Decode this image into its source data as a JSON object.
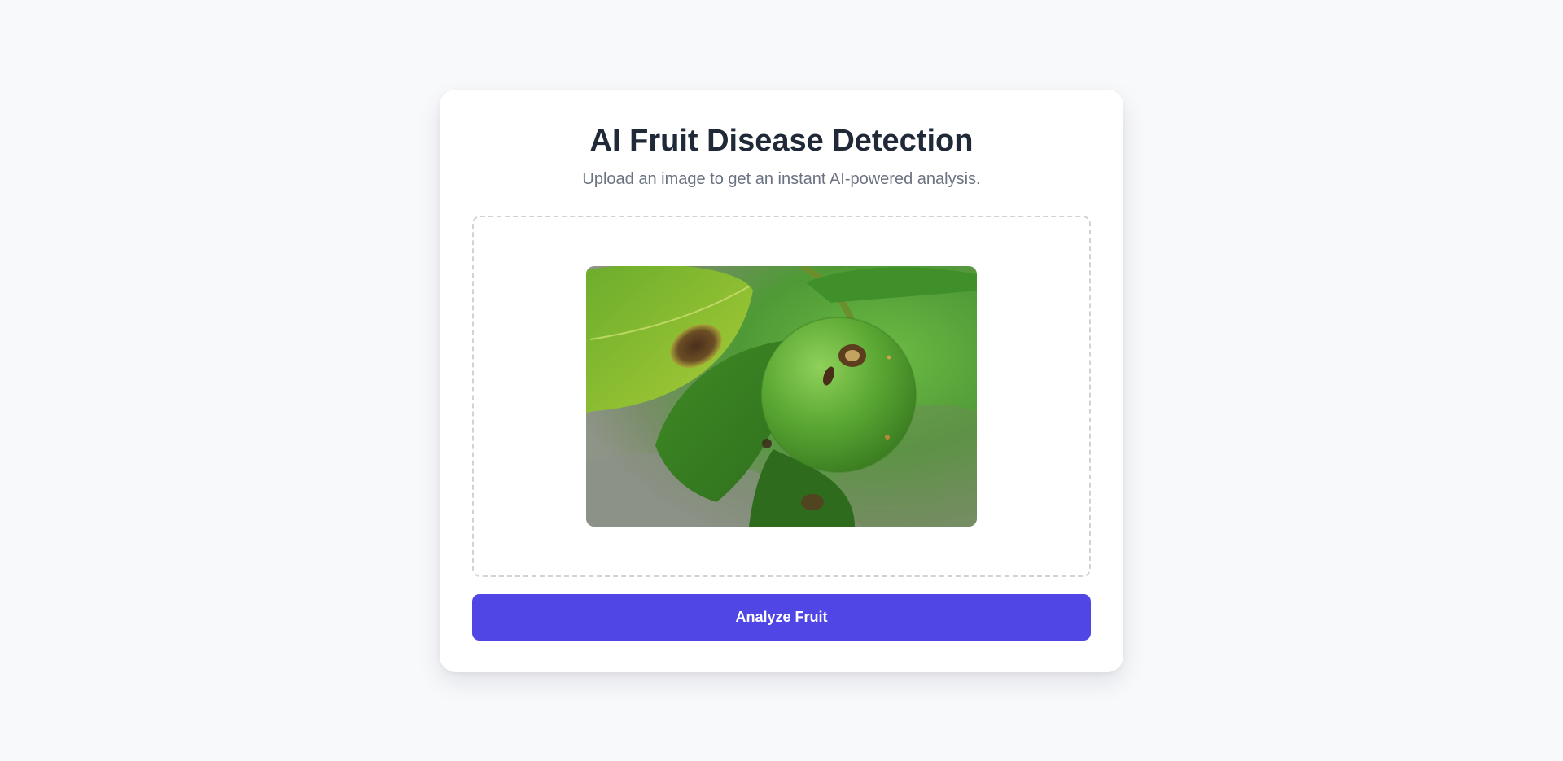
{
  "header": {
    "title": "AI Fruit Disease Detection",
    "subtitle": "Upload an image to get an instant AI-powered analysis."
  },
  "upload": {
    "preview_icon": "fruit-image-preview"
  },
  "actions": {
    "analyze_label": "Analyze Fruit"
  },
  "colors": {
    "page_background": "#f8f9fb",
    "card_background": "#ffffff",
    "title": "#1f2937",
    "subtitle": "#6b7280",
    "dropzone_border": "#cfd3d8",
    "button": "#4f46e5",
    "button_text": "#ffffff"
  }
}
